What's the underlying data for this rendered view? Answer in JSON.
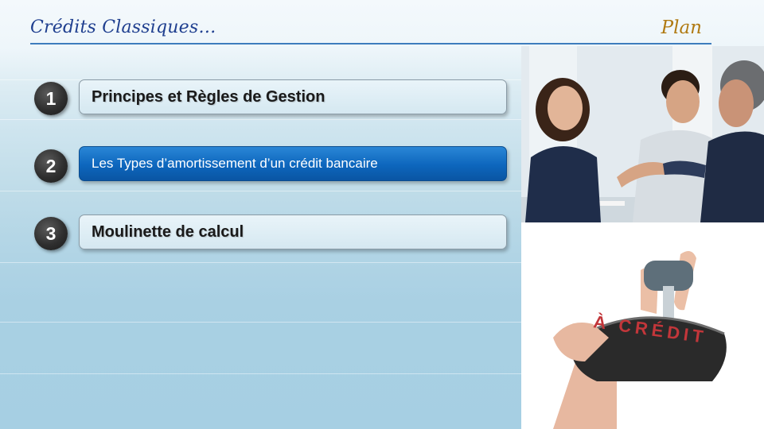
{
  "header": {
    "title": "Crédits Classiques…",
    "section": "Plan"
  },
  "plan_items": [
    {
      "number": "1",
      "label": "Principes et Règles de Gestion",
      "active": false
    },
    {
      "number": "2",
      "label": "Les Types d’amortissement d’un crédit bancaire",
      "active": true
    },
    {
      "number": "3",
      "label": "Moulinette de calcul",
      "active": false
    }
  ],
  "images": {
    "top": "people-handshake-photo",
    "bottom": "credit-pouch-photo",
    "pouch_text": "À CRÉDIT"
  },
  "colors": {
    "title": "#1f3f8f",
    "section": "#b07a12",
    "rule": "#3d7dbd",
    "active_item": "#0d66bd",
    "number_badge": "#2f2f2f"
  }
}
